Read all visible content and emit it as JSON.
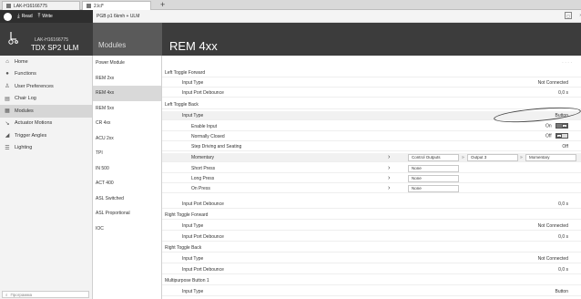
{
  "tabs": [
    {
      "label": "LAK-H16166775"
    },
    {
      "label": "2.lcl*"
    }
  ],
  "toolbar": {
    "read_label": "Read",
    "write_label": "Write",
    "program": "PGB p1 6kmh + ULM",
    "icon": "panel-icon"
  },
  "device": {
    "serial": "LAK-H16166775",
    "model": "TDX SP2 ULM"
  },
  "modules_title": "Modules",
  "page_title": "REM 4xx",
  "nav": [
    {
      "label": "Home",
      "icon": "home-icon"
    },
    {
      "label": "Functions",
      "icon": "functions-icon"
    },
    {
      "label": "User Preferences",
      "icon": "user-icon"
    },
    {
      "label": "Chair Log",
      "icon": "log-icon"
    },
    {
      "label": "Modules",
      "icon": "modules-icon",
      "active": true
    },
    {
      "label": "Actuator Motions",
      "icon": "actuator-icon"
    },
    {
      "label": "Trigger Angles",
      "icon": "trigger-icon"
    },
    {
      "label": "Lighting",
      "icon": "lighting-icon"
    }
  ],
  "search": {
    "placeholder": "Программа"
  },
  "modules": [
    "Power Module",
    "REM 2xx",
    "REM 4xx",
    "REM 5xx",
    "CR 4xx",
    "ACU 2xx",
    "TPI",
    "IN 500",
    "ACT 400",
    "ASL Switched",
    "ASL Proportional",
    "IOC"
  ],
  "main": {
    "rows": [
      {
        "label": "Left Toggle Forward",
        "kind": "section"
      },
      {
        "label": "Input Type",
        "kind": "l1",
        "value": "Not Connected"
      },
      {
        "label": "Input Port Debounce",
        "kind": "l1",
        "value": "0,0 s"
      },
      {
        "label": "Left Toggle Back",
        "kind": "section"
      },
      {
        "label": "Input Type",
        "kind": "l1",
        "value": "Button",
        "shade": true
      },
      {
        "label": "Enable Input",
        "kind": "l2",
        "value": "On"
      },
      {
        "label": "Normally Closed",
        "kind": "l2",
        "value": "Off"
      },
      {
        "label": "Step Driving and Seating",
        "kind": "l2",
        "value": "Off"
      },
      {
        "label": "Momentary",
        "kind": "l2",
        "shade": true
      },
      {
        "label": "Short Press",
        "kind": "l2"
      },
      {
        "label": "Long Press",
        "kind": "l2"
      },
      {
        "label": "On Press",
        "kind": "l2"
      },
      {
        "label": "Input Port Debounce",
        "kind": "l1",
        "value": "0,0 s"
      },
      {
        "label": "Right Toggle Forward",
        "kind": "section"
      },
      {
        "label": "Input Type",
        "kind": "l1",
        "value": "Not Connected"
      },
      {
        "label": "Input Port Debounce",
        "kind": "l1",
        "value": "0,0 s"
      },
      {
        "label": "Right Toggle Back",
        "kind": "section"
      },
      {
        "label": "Input Type",
        "kind": "l1",
        "value": "Not Connected"
      },
      {
        "label": "Input Port Debounce",
        "kind": "l1",
        "value": "0,0 s"
      },
      {
        "label": "Multipurpose Button 1",
        "kind": "section"
      },
      {
        "label": "Input Type",
        "kind": "l1",
        "value": "Button"
      }
    ],
    "toggle_on": "✓",
    "toggle_off": "×",
    "momentary_fields": [
      "Control Outputs",
      "Output 3",
      "Momentary"
    ],
    "none_label": "None",
    "ellipsis": "· · · ·"
  }
}
